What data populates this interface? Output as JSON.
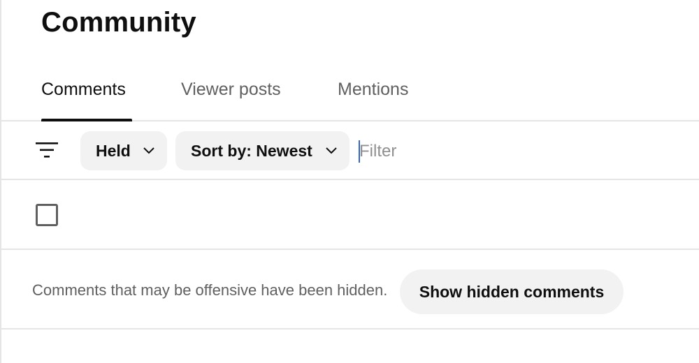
{
  "header": {
    "title": "Community"
  },
  "tabs": [
    {
      "label": "Comments",
      "active": true
    },
    {
      "label": "Viewer posts",
      "active": false
    },
    {
      "label": "Mentions",
      "active": false
    }
  ],
  "toolbar": {
    "filter_icon": "filter-lines-icon",
    "held_chip": "Held",
    "sort_chip": "Sort by: Newest",
    "filter_placeholder": "Filter"
  },
  "notice": {
    "text": "Comments that may be offensive have been hidden.",
    "button_label": "Show hidden comments"
  },
  "colors": {
    "text_primary": "#0f0f0f",
    "text_secondary": "#606060",
    "chip_bg": "#f2f2f2",
    "divider": "#e5e5e5",
    "caret": "#3366cc"
  }
}
